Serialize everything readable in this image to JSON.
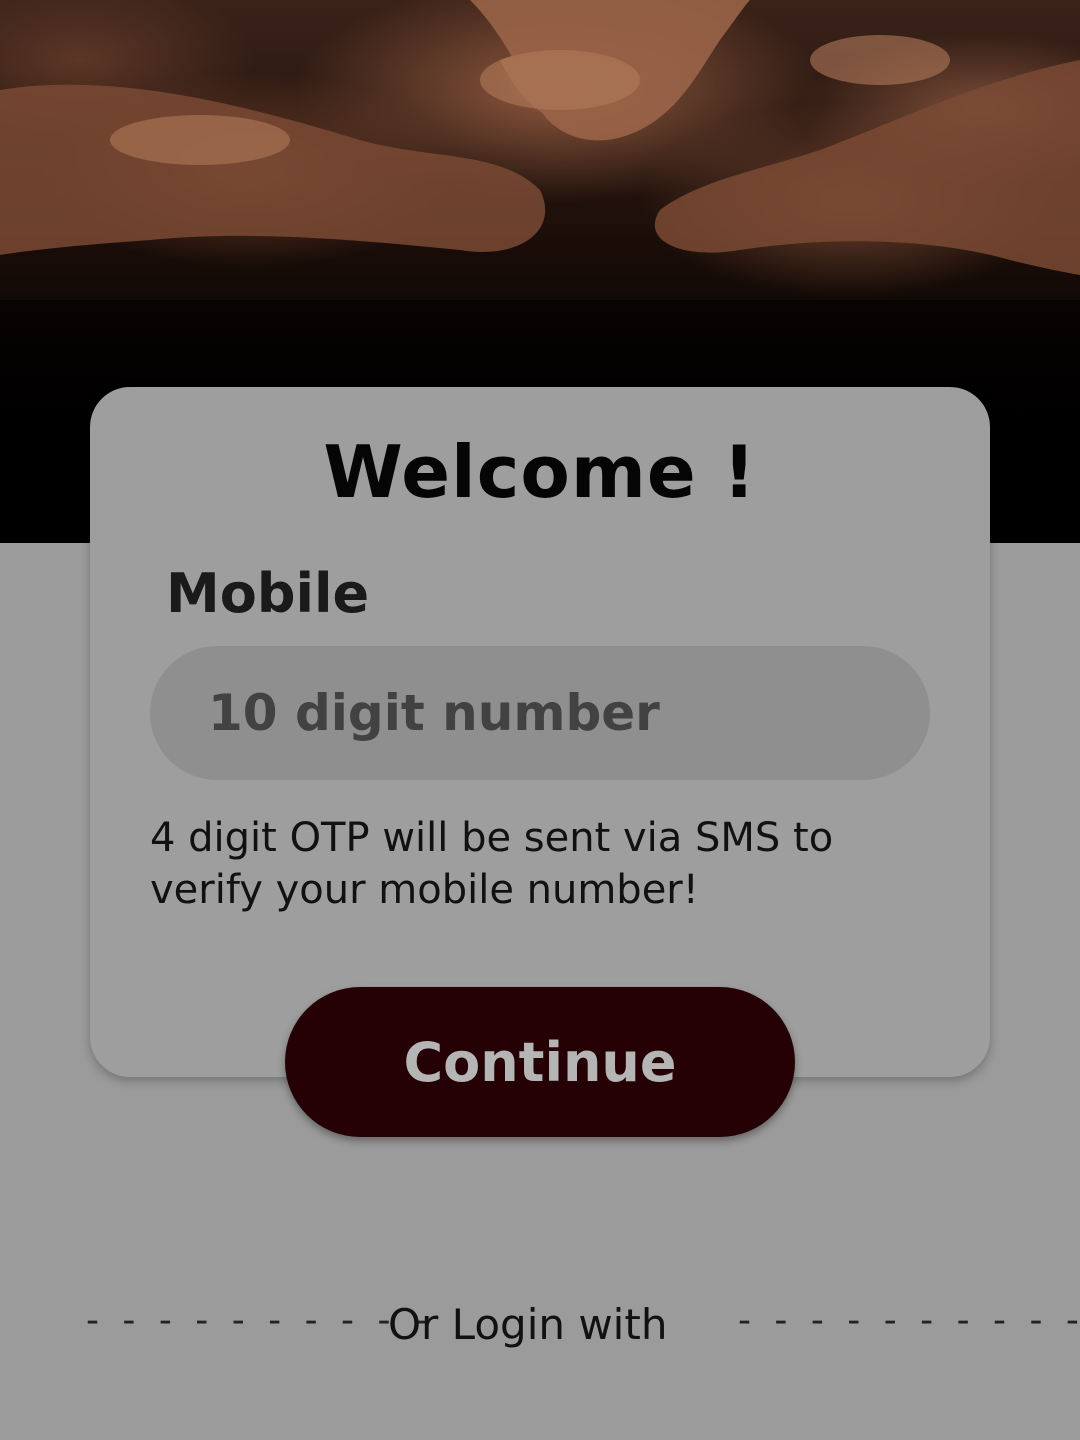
{
  "hero": {
    "image": "hands-stacked-teamwork-photo"
  },
  "card": {
    "title": "Welcome !",
    "mobile_label": "Mobile",
    "mobile_input": {
      "placeholder": "10 digit number",
      "value": ""
    },
    "hint": "4 digit OTP will be sent via SMS to verify your mobile number!"
  },
  "continue_button": {
    "label": "Continue"
  },
  "footer": {
    "divider_left": "- - - - -  - - - - -",
    "or_login_text": "Or Login with",
    "divider_right": "- - - - - - - - - - - -"
  },
  "colors": {
    "background": "#9b9b9b",
    "card": "#9e9e9e",
    "input": "#8f8f8f",
    "button": "#250005",
    "button_text": "#b5b5b5"
  }
}
